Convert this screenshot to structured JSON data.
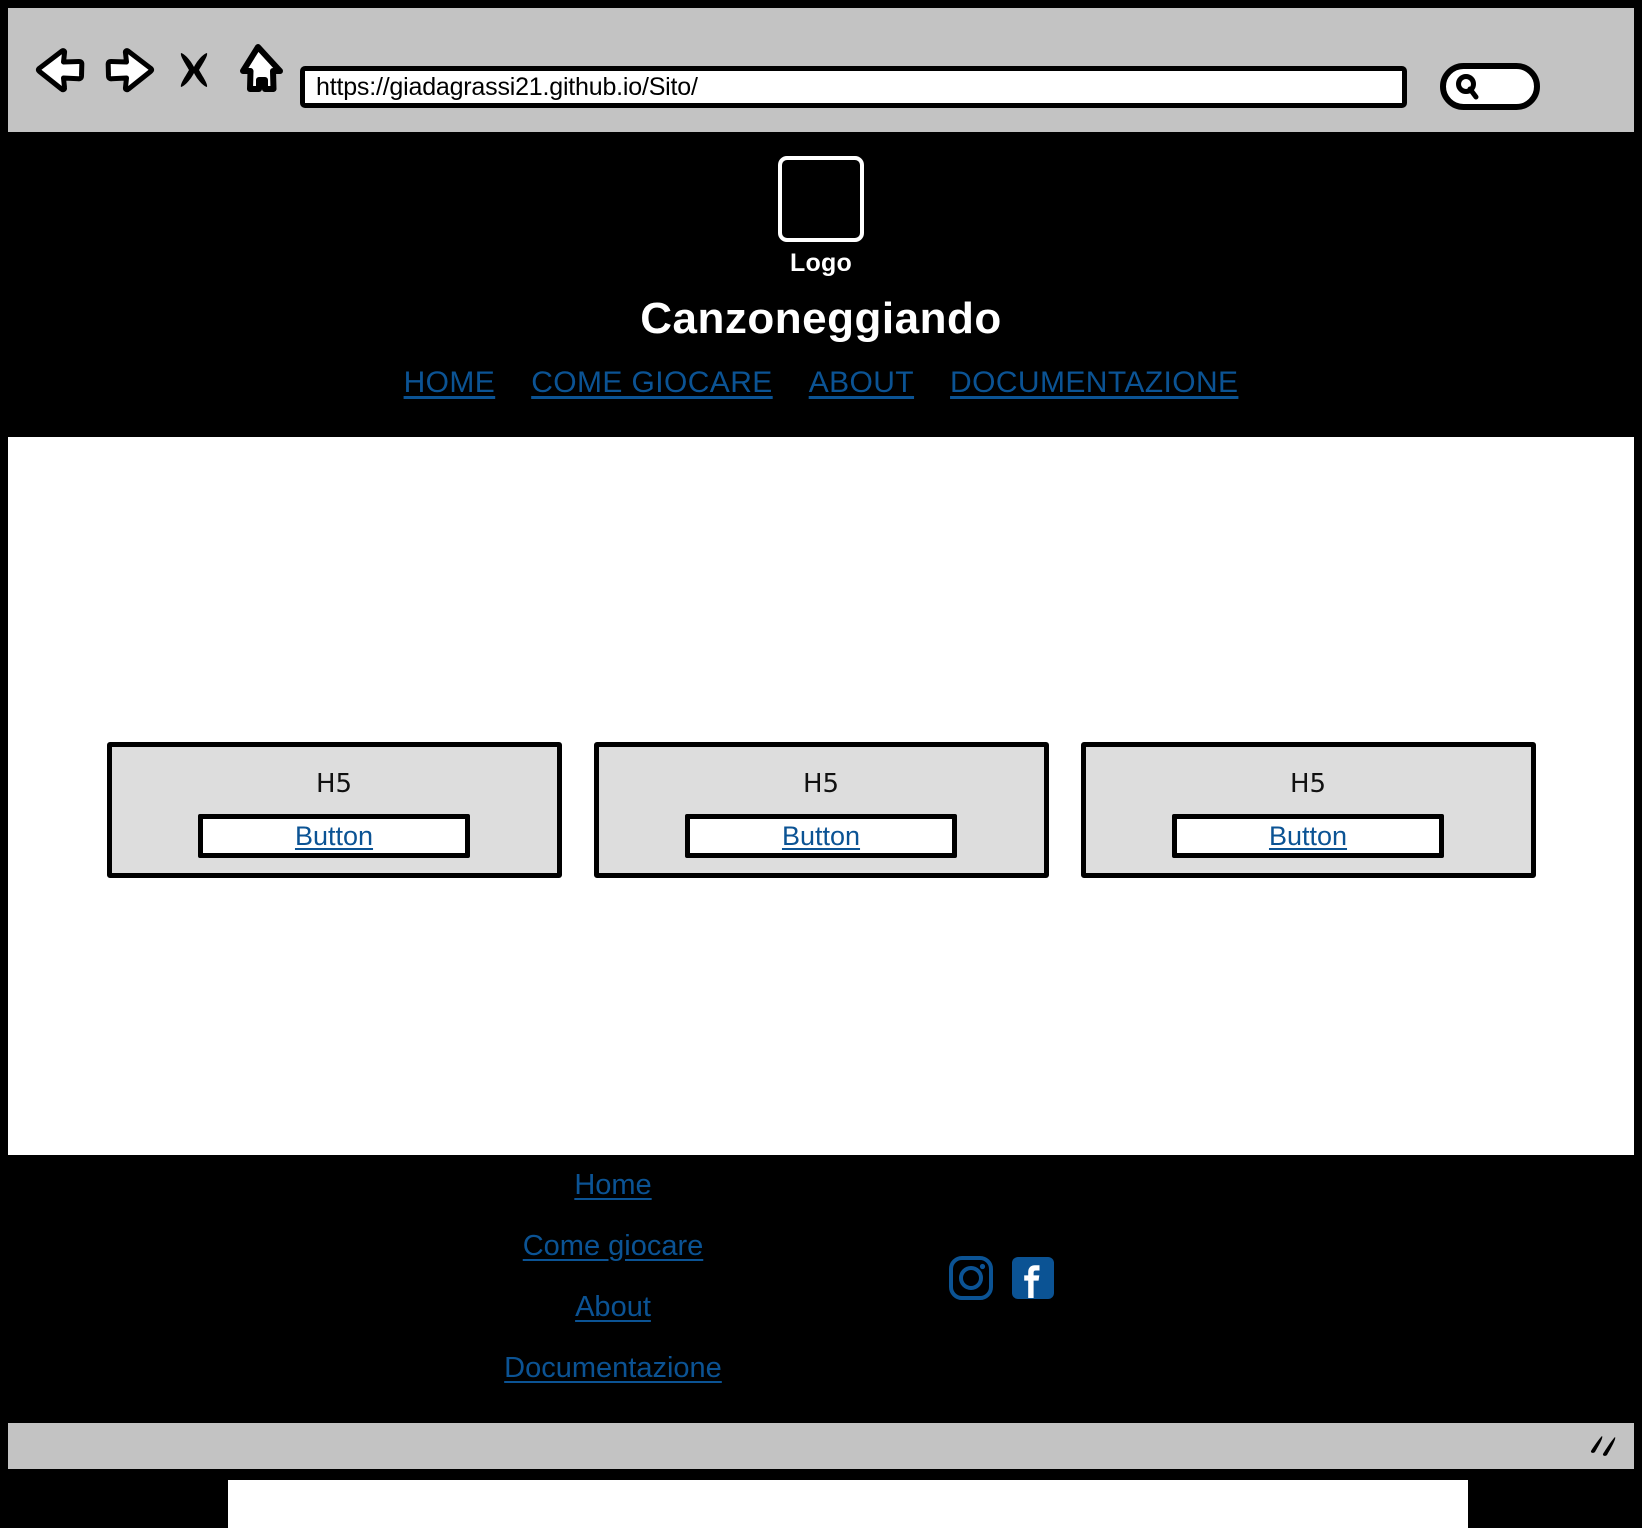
{
  "browser": {
    "url": "https://giadagrassi21.github.io/Sito/",
    "url_placeholder": "Enter URL",
    "back_icon": "back-arrow-icon",
    "forward_icon": "forward-arrow-icon",
    "stop_icon": "close-x-icon",
    "home_icon": "home-icon",
    "search_icon": "search-icon",
    "search_value": "",
    "search_placeholder": "",
    "resize_icon": "resize-grip-icon",
    "toolbar_color": "#c3c3c3"
  },
  "header": {
    "logo_caption": "Logo",
    "title": "Canzoneggiando",
    "nav": [
      {
        "label": "HOME"
      },
      {
        "label": "COME GIOCARE"
      },
      {
        "label": "ABOUT"
      },
      {
        "label": "DOCUMENTAZIONE"
      }
    ],
    "background": "#000000",
    "title_color": "#ffffff",
    "link_color": "#0b5394"
  },
  "main": {
    "cards": [
      {
        "heading": "H5",
        "button_label": "Button"
      },
      {
        "heading": "H5",
        "button_label": "Button"
      },
      {
        "heading": "H5",
        "button_label": "Button"
      }
    ],
    "card_background": "#dddddd",
    "background": "#ffffff"
  },
  "footer": {
    "links": [
      {
        "label": "Home"
      },
      {
        "label": "Come giocare"
      },
      {
        "label": "About"
      },
      {
        "label": "Documentazione"
      }
    ],
    "socials": [
      {
        "name": "instagram-icon"
      },
      {
        "name": "facebook-icon"
      }
    ],
    "background": "#000000",
    "link_color": "#0b5394"
  }
}
